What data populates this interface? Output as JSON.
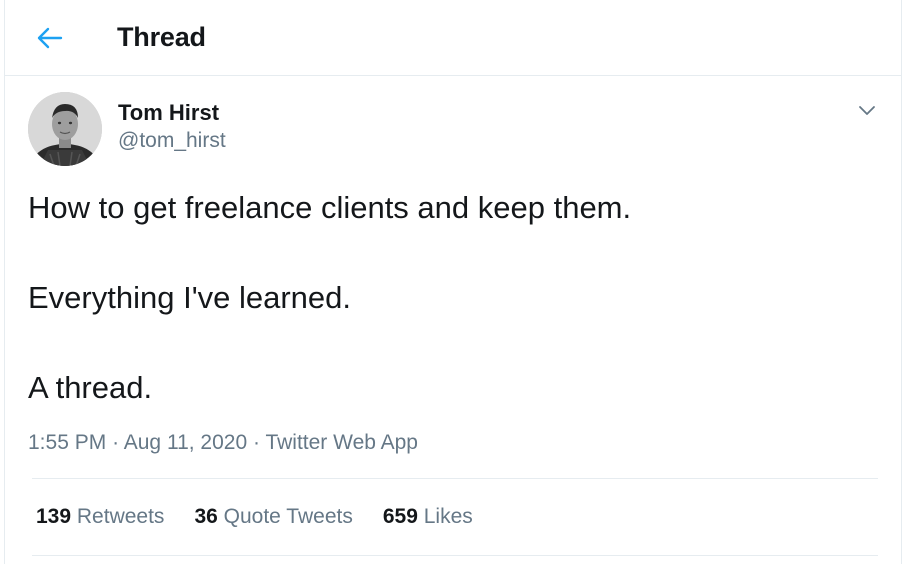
{
  "header": {
    "back_icon": "arrow-left-icon",
    "title": "Thread",
    "accent_color": "#1da1f2"
  },
  "tweet": {
    "author": {
      "name": "Tom Hirst",
      "handle": "@tom_hirst",
      "avatar_icon": "user-avatar"
    },
    "menu_icon": "chevron-down-icon",
    "body_lines": [
      "How to get freelance clients and keep them.",
      "Everything I've learned.",
      "A thread."
    ],
    "meta": {
      "time": "1:55 PM",
      "separator": "·",
      "date": "Aug 11, 2020",
      "source": "Twitter Web App"
    },
    "stats": {
      "retweets_count": "139",
      "retweets_label": "Retweets",
      "quotes_count": "36",
      "quotes_label": "Quote Tweets",
      "likes_count": "659",
      "likes_label": "Likes"
    }
  }
}
